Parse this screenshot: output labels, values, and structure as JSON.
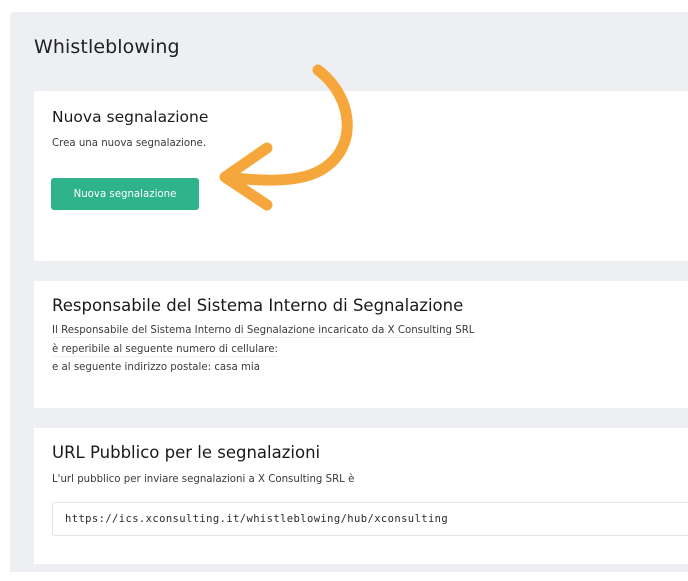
{
  "page": {
    "title": "Whistleblowing"
  },
  "new_report": {
    "title": "Nuova segnalazione",
    "description": "Crea una nuova segnalazione.",
    "button_label": "Nuova segnalazione"
  },
  "responsible": {
    "title": "Responsabile del Sistema Interno di Segnalazione",
    "lines": [
      "Il Responsabile del Sistema Interno di Segnalazione incaricato da X Consulting SRL",
      "è reperibile al seguente numero di cellulare:",
      "e al seguente indirizzo postale: casa mia"
    ]
  },
  "public_url": {
    "title": "URL Pubblico per le segnalazioni",
    "description": "L'url pubblico per inviare segnalazioni a X Consulting SRL è",
    "url_value": "https://ics.xconsulting.it/whistleblowing/hub/xconsulting"
  },
  "annotation": {
    "arrow_color": "#f5a73b",
    "icon": "curved-arrow-icon"
  },
  "colors": {
    "accent": "#2eb38a",
    "background": "#eeeff2",
    "card": "#ffffff"
  }
}
